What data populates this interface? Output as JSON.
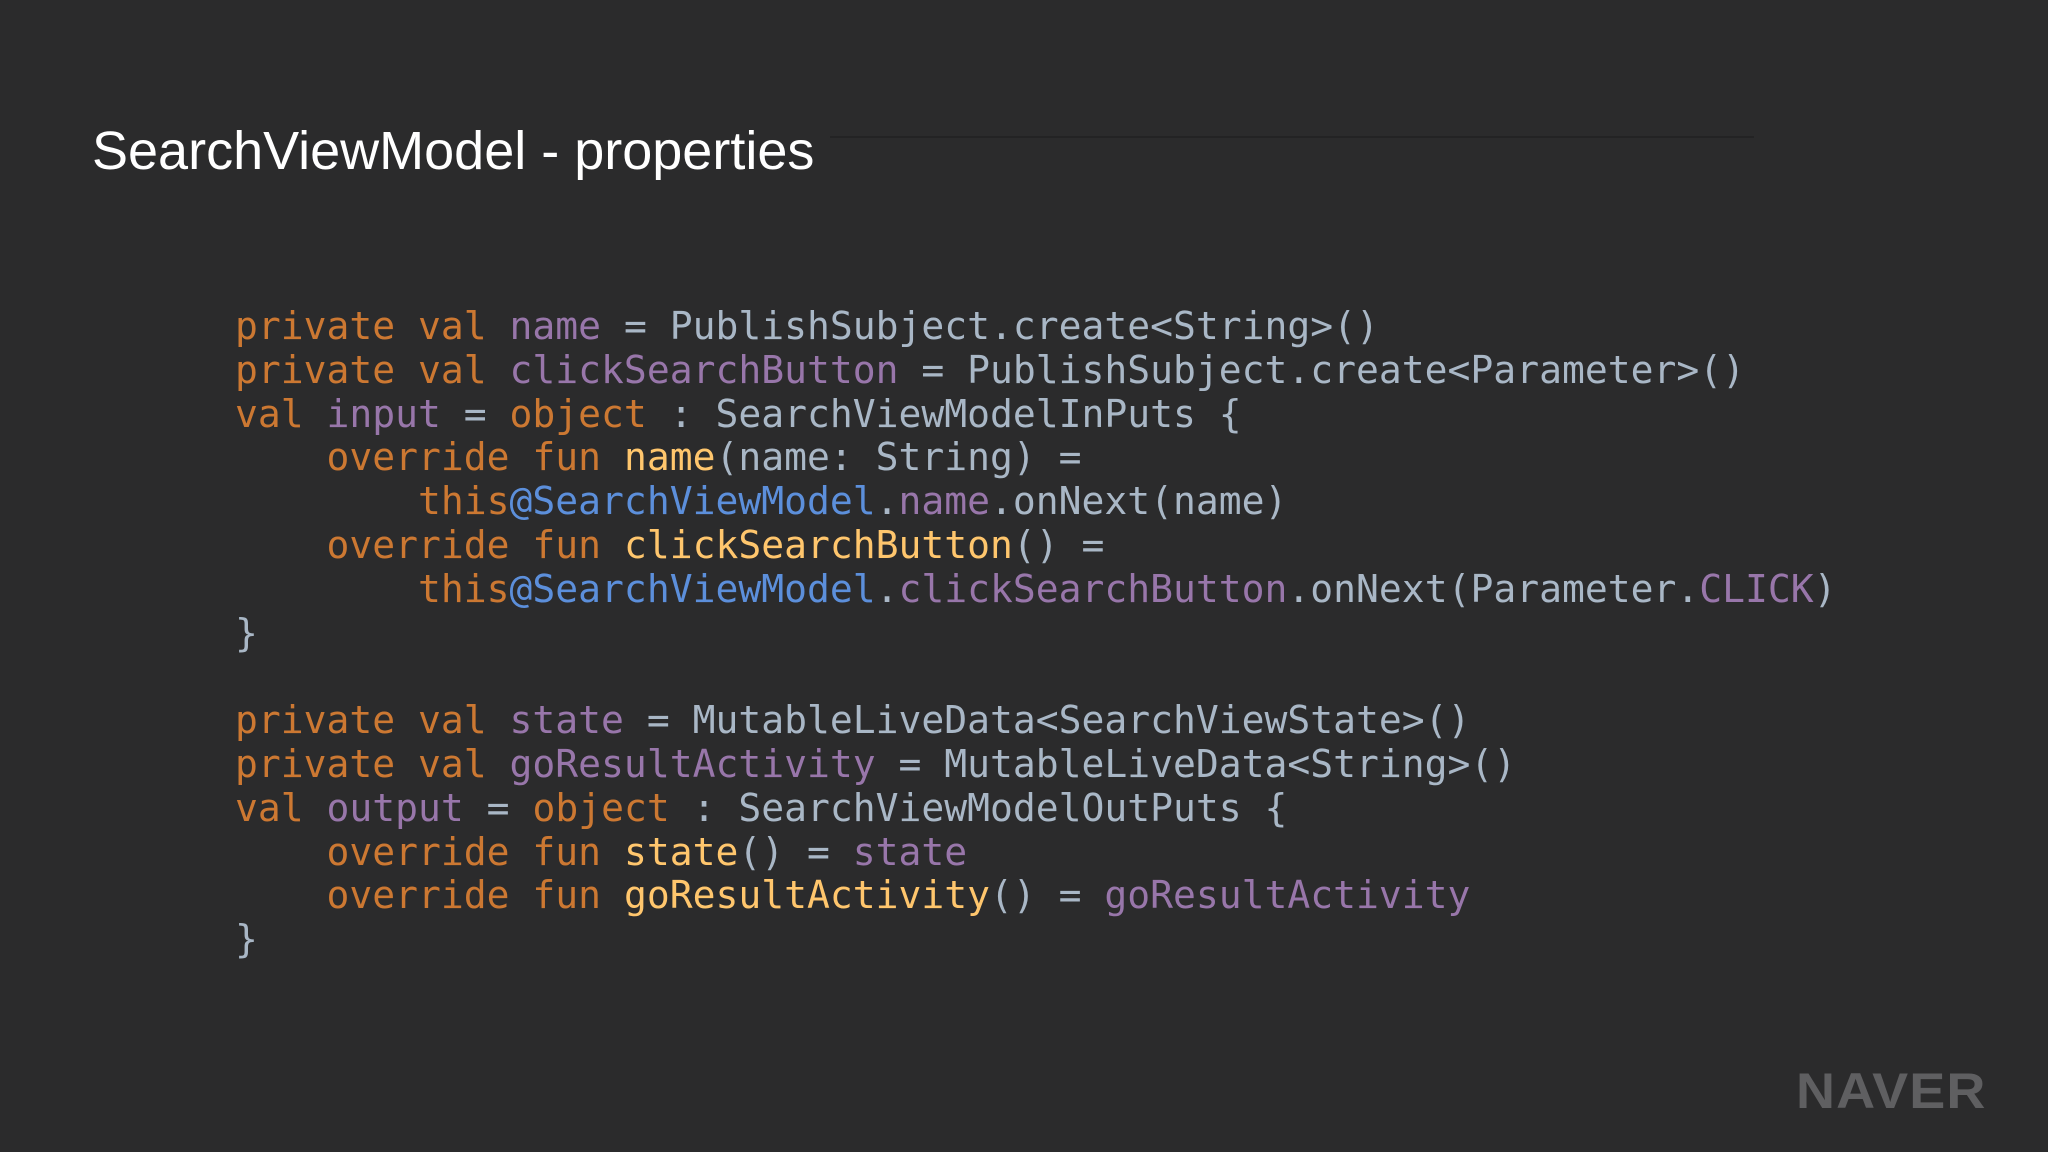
{
  "slide": {
    "title": "SearchViewModel - properties",
    "logo": "NAVER"
  },
  "colors": {
    "background": "#2b2b2c",
    "title": "#ffffff",
    "keyword": "#cc7832",
    "property": "#9876aa",
    "function": "#ffc66d",
    "label": "#5c8fdb",
    "plain": "#a9b7c6",
    "logo": "#5f5f61"
  },
  "code": {
    "lines": [
      [
        {
          "t": "private val ",
          "k": "kw"
        },
        {
          "t": "name",
          "k": "prop"
        },
        {
          "t": " = PublishSubject.create<String>()",
          "k": "plain"
        }
      ],
      [
        {
          "t": "private val ",
          "k": "kw"
        },
        {
          "t": "clickSearchButton",
          "k": "prop"
        },
        {
          "t": " = PublishSubject.create<Parameter>()",
          "k": "plain"
        }
      ],
      [
        {
          "t": "val ",
          "k": "kw"
        },
        {
          "t": "input",
          "k": "prop"
        },
        {
          "t": " = ",
          "k": "plain"
        },
        {
          "t": "object",
          "k": "kw"
        },
        {
          "t": " : SearchViewModelInPuts {",
          "k": "plain"
        }
      ],
      [
        {
          "t": "    override fun ",
          "k": "kw"
        },
        {
          "t": "name",
          "k": "fn"
        },
        {
          "t": "(name: String) =",
          "k": "plain"
        }
      ],
      [
        {
          "t": "        this",
          "k": "kw"
        },
        {
          "t": "@SearchViewModel",
          "k": "label"
        },
        {
          "t": ".",
          "k": "plain"
        },
        {
          "t": "name",
          "k": "prop"
        },
        {
          "t": ".onNext(name)",
          "k": "plain"
        }
      ],
      [
        {
          "t": "    override fun ",
          "k": "kw"
        },
        {
          "t": "clickSearchButton",
          "k": "fn"
        },
        {
          "t": "() =",
          "k": "plain"
        }
      ],
      [
        {
          "t": "        this",
          "k": "kw"
        },
        {
          "t": "@SearchViewModel",
          "k": "label"
        },
        {
          "t": ".",
          "k": "plain"
        },
        {
          "t": "clickSearchButton",
          "k": "prop"
        },
        {
          "t": ".onNext(Parameter.",
          "k": "plain"
        },
        {
          "t": "CLICK",
          "k": "prop"
        },
        {
          "t": ")",
          "k": "plain"
        }
      ],
      [
        {
          "t": "}",
          "k": "plain"
        }
      ],
      [],
      [
        {
          "t": "private val ",
          "k": "kw"
        },
        {
          "t": "state",
          "k": "prop"
        },
        {
          "t": " = MutableLiveData<SearchViewState>()",
          "k": "plain"
        }
      ],
      [
        {
          "t": "private val ",
          "k": "kw"
        },
        {
          "t": "goResultActivity",
          "k": "prop"
        },
        {
          "t": " = MutableLiveData<String>()",
          "k": "plain"
        }
      ],
      [
        {
          "t": "val ",
          "k": "kw"
        },
        {
          "t": "output",
          "k": "prop"
        },
        {
          "t": " = ",
          "k": "plain"
        },
        {
          "t": "object",
          "k": "kw"
        },
        {
          "t": " : SearchViewModelOutPuts {",
          "k": "plain"
        }
      ],
      [
        {
          "t": "    override fun ",
          "k": "kw"
        },
        {
          "t": "state",
          "k": "fn"
        },
        {
          "t": "() = ",
          "k": "plain"
        },
        {
          "t": "state",
          "k": "prop"
        }
      ],
      [
        {
          "t": "    override fun ",
          "k": "kw"
        },
        {
          "t": "goResultActivity",
          "k": "fn"
        },
        {
          "t": "() = ",
          "k": "plain"
        },
        {
          "t": "goResultActivity",
          "k": "prop"
        }
      ],
      [
        {
          "t": "}",
          "k": "plain"
        }
      ]
    ]
  }
}
